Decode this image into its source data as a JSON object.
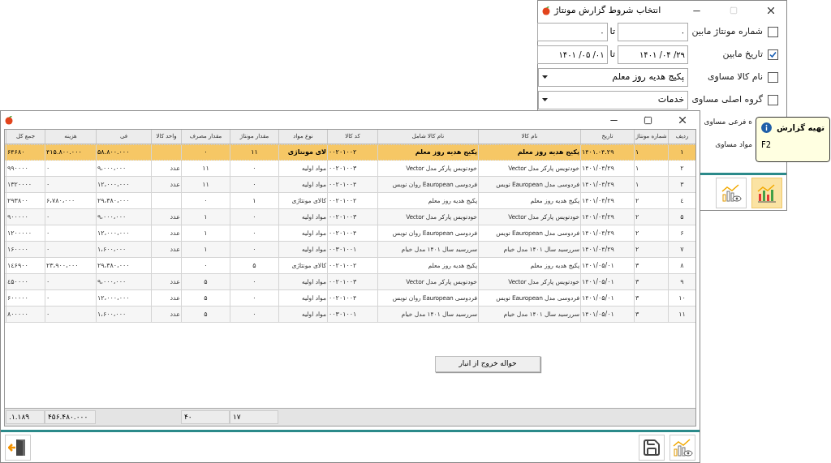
{
  "conditions_dialog": {
    "title": "انتخاب شروط گزارش مونتاژ",
    "conditions": [
      {
        "kind": "range",
        "label": "شماره مونتاژ مابین",
        "checked": false,
        "from": "۰",
        "separator": "تا",
        "to": "۰"
      },
      {
        "kind": "range",
        "label": "تاریخ مابین",
        "checked": true,
        "from": "۱۴۰۱ /۰۴ /۲۹",
        "separator": "تا",
        "to": "۱۴۰۱ /۰۵ /۰۱"
      },
      {
        "kind": "select",
        "label": "نام کالا مساوی",
        "checked": false,
        "value": "پکیج هدیه روز معلم"
      },
      {
        "kind": "select",
        "label": "گروه اصلی مساوی",
        "checked": false,
        "value": "خدمات"
      },
      {
        "kind": "label",
        "label": "ه فرعی مساوی"
      },
      {
        "kind": "label",
        "label": "مواد مساوی"
      }
    ],
    "buttons": [
      {
        "kind": "chart",
        "highlighted": true
      },
      {
        "kind": "chart_eye",
        "highlighted": false
      }
    ]
  },
  "tooltip": {
    "title": "تهیه گزارش",
    "shortcut": "F2"
  },
  "report_window": {
    "table": {
      "columns": [
        {
          "label": "ردیف"
        },
        {
          "label": "شماره مونتاژ"
        },
        {
          "label": "تاریخ"
        },
        {
          "label": "نام کالا"
        },
        {
          "label": "نام کالا شامل"
        },
        {
          "label": "کد کالا"
        },
        {
          "label": "نوع مواد"
        },
        {
          "label": "مقدار مونتاژ",
          "total": "۱۷"
        },
        {
          "label": "مقدار مصرف",
          "total": "۴۰"
        },
        {
          "label": "واحد کالا"
        },
        {
          "label": "فی"
        },
        {
          "label": "هزینه",
          "total": "۴۵۶.۴۸۰.۰۰۰"
        },
        {
          "label": "جمع کل",
          "total": "۱.۱۸۹."
        }
      ],
      "rows": [
        {
          "selected": true,
          "cells": [
            "۱",
            "۱",
            "۱۴۰۱.۰۴.۲۹",
            "پکیج هدیه روز معلم",
            "پکیج هدیه روز معلم",
            "۰۰۲۰۱۰۰۲",
            "لای مونتاژی",
            "۱۱",
            "۰",
            "",
            "۵۸.۸۰۰.۰۰۰",
            "۴۱۵.۸۰۰.۰۰۰",
            "۶۴۶۸۰"
          ]
        },
        {
          "selected": false,
          "cells": [
            "۲",
            "۱",
            "۱۴۰۱/۰۴/۲۹",
            "خودنویس پارکر مدل Vector",
            "خودنویس پارکر مدل Vector",
            "۰۰۲۰۱۰۰۳",
            "مواد اولیه",
            "۰",
            "۱۱",
            "عدد",
            "۹،۰۰۰،۰۰۰",
            "۰",
            "۹۹۰۰۰۰"
          ]
        },
        {
          "selected": false,
          "cells": [
            "۳",
            "۱",
            "۱۴۰۱/۰۴/۲۹",
            "فردوسی مدل Eauropean نویس",
            "فردوسی Eauropean روان نویس",
            "۰۰۲۰۱۰۰۴",
            "مواد اولیه",
            "۰",
            "۱۱",
            "عدد",
            "۱۲،۰۰۰،۰۰۰",
            "۰",
            "۱۳۲۰۰۰۰"
          ]
        },
        {
          "selected": false,
          "cells": [
            "٤",
            "۲",
            "۱۴۰۱/۰۴/۲۹",
            "پکیج هدیه روز معلم",
            "پکیج هدیه روز معلم",
            "۰۰۲۰۱۰۰۲",
            "کالای مونتاژی",
            "۱",
            "۰",
            "",
            "۲۹،۳۸۰،۰۰۰",
            "۶،۷۸۰،۰۰۰",
            "۲۹۳۸۰۰"
          ]
        },
        {
          "selected": false,
          "cells": [
            "۵",
            "۲",
            "۱۴۰۱/۰۴/۲۹",
            "خودنویس پارکر مدل Vector",
            "خودنویس پارکر مدل Vector",
            "۰۰۲۰۱۰۰۳",
            "مواد اولیه",
            "۰",
            "۱",
            "عدد",
            "۹،۰۰۰،۰۰۰",
            "۰",
            "۹۰۰۰۰۰"
          ]
        },
        {
          "selected": false,
          "cells": [
            "۶",
            "۲",
            "۱۴۰۱/۰۴/۲۹",
            "فردوسی مدل Eauropean نویس",
            "فردوسی Eauropean روان نویس",
            "۰۰۲۰۱۰۰۴",
            "مواد اولیه",
            "۰",
            "۱",
            "عدد",
            "۱۲،۰۰۰،۰۰۰",
            "۰",
            "۱۲۰۰۰۰۰"
          ]
        },
        {
          "selected": false,
          "cells": [
            "۷",
            "۲",
            "۱۴۰۱/۰۴/۲۹",
            "سررسید سال ۱۴۰۱ مدل خیام",
            "سررسید سال ۱۴۰۱ مدل خیام",
            "۰۰۳۰۱۰۰۱",
            "مواد اولیه",
            "۰",
            "۱",
            "عدد",
            "۱،۶۰۰،۰۰۰",
            "۰",
            "۱۶۰۰۰۰"
          ]
        },
        {
          "selected": false,
          "cells": [
            "۸",
            "۳",
            "۱۴۰۱/۰۵/۰۱",
            "پکیج هدیه روز معلم",
            "پکیج هدیه روز معلم",
            "۰۰۲۰۱۰۰۲",
            "کالای مونتاژی",
            "۵",
            "۰",
            "",
            "۲۹،۳۸۰،۰۰۰",
            "۲۳،۹۰۰،۰۰۰",
            "۱٤۶۹۰۰"
          ]
        },
        {
          "selected": false,
          "cells": [
            "۹",
            "۳",
            "۱۴۰۱/۰۵/۰۱",
            "خودنویس پارکر مدل Vector",
            "خودنویس پارکر مدل Vector",
            "۰۰۲۰۱۰۰۳",
            "مواد اولیه",
            "۰",
            "۵",
            "عدد",
            "۹،۰۰۰،۰۰۰",
            "۰",
            "٤۵۰۰۰۰"
          ]
        },
        {
          "selected": false,
          "cells": [
            "۱۰",
            "۳",
            "۱۴۰۱/۰۵/۰۱",
            "فردوسی مدل Eauropean نویس",
            "فردوسی Eauropean روان نویس",
            "۰۰۲۰۱۰۰۴",
            "مواد اولیه",
            "۰",
            "۵",
            "عدد",
            "۱۲،۰۰۰،۰۰۰",
            "۰",
            "۶۰۰۰۰۰"
          ]
        },
        {
          "selected": false,
          "cells": [
            "۱۱",
            "۳",
            "۱۴۰۱/۰۵/۰۱",
            "سررسید سال ۱۴۰۱ مدل خیام",
            "سررسید سال ۱۴۰۱ مدل خیام",
            "۰۰۳۰۱۰۰۱",
            "مواد اولیه",
            "۰",
            "۵",
            "عدد",
            "۱،۶۰۰،۰۰۰",
            "۰",
            "۸۰۰۰۰۰"
          ]
        }
      ]
    },
    "action_button": "حواله خروج از انبار",
    "buttons": [
      {
        "kind": "chart_eye"
      },
      {
        "kind": "save"
      },
      {
        "kind": "exit"
      }
    ]
  }
}
